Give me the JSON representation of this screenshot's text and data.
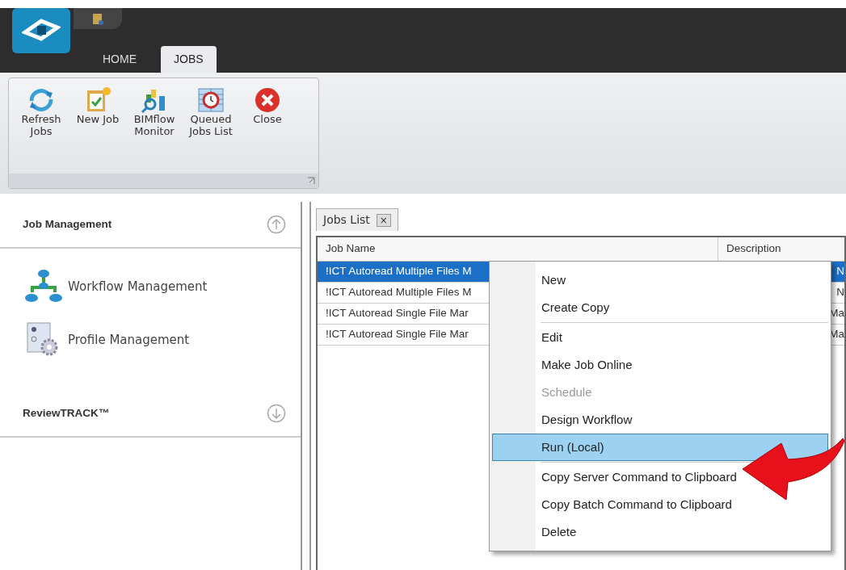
{
  "ribbon": {
    "tabs": [
      {
        "label": "HOME",
        "selected": false
      },
      {
        "label": "JOBS",
        "selected": true
      }
    ],
    "buttons": [
      {
        "kind": "refresh",
        "label": "Refresh Jobs"
      },
      {
        "kind": "new",
        "label": "New Job"
      },
      {
        "kind": "monitor",
        "label": "BIMflow Monitor"
      },
      {
        "kind": "queue",
        "label": "Queued Jobs List"
      },
      {
        "kind": "close",
        "label": "Close"
      }
    ]
  },
  "sidebar": {
    "sections": [
      {
        "title": "Job Management",
        "expanded": true,
        "items": [
          {
            "kind": "workflow",
            "label": "Workflow Management"
          },
          {
            "kind": "profile",
            "label": "Profile Management"
          }
        ]
      },
      {
        "title": "ReviewTRACK™",
        "expanded": false
      }
    ]
  },
  "document_tab": {
    "label": "Jobs List",
    "close": "×"
  },
  "table": {
    "columns": [
      "Job Name",
      "Description"
    ],
    "rows": [
      {
        "cells": [
          "!ICT Autoread Multiple Files M",
          "N"
        ],
        "selected": true
      },
      {
        "cells": [
          "!ICT Autoread Multiple Files M",
          "N"
        ],
        "selected": false
      },
      {
        "cells": [
          "!ICT Autoread Single File Mar",
          "Ma"
        ],
        "selected": false
      },
      {
        "cells": [
          "!ICT Autoread Single File Mar",
          "Ma"
        ],
        "selected": false
      }
    ]
  },
  "context_menu": {
    "items": [
      {
        "kind": "item",
        "label": "New",
        "disabled": false,
        "selected": false
      },
      {
        "kind": "item",
        "label": "Create Copy",
        "disabled": false,
        "selected": false
      },
      {
        "kind": "separator"
      },
      {
        "kind": "item",
        "label": "Edit",
        "disabled": false,
        "selected": false
      },
      {
        "kind": "item",
        "label": "Make Job Online",
        "disabled": false,
        "selected": false
      },
      {
        "kind": "item",
        "label": "Schedule",
        "disabled": true,
        "selected": false
      },
      {
        "kind": "item",
        "label": "Design Workflow",
        "disabled": false,
        "selected": false
      },
      {
        "kind": "item",
        "label": "Run (Local)",
        "disabled": false,
        "selected": true
      },
      {
        "kind": "separator"
      },
      {
        "kind": "item",
        "label": "Copy Server Command to Clipboard",
        "disabled": false,
        "selected": false
      },
      {
        "kind": "item",
        "label": "Copy Batch Command to Clipboard",
        "disabled": false,
        "selected": false
      },
      {
        "kind": "item",
        "label": "Delete",
        "disabled": false,
        "selected": false
      }
    ]
  }
}
